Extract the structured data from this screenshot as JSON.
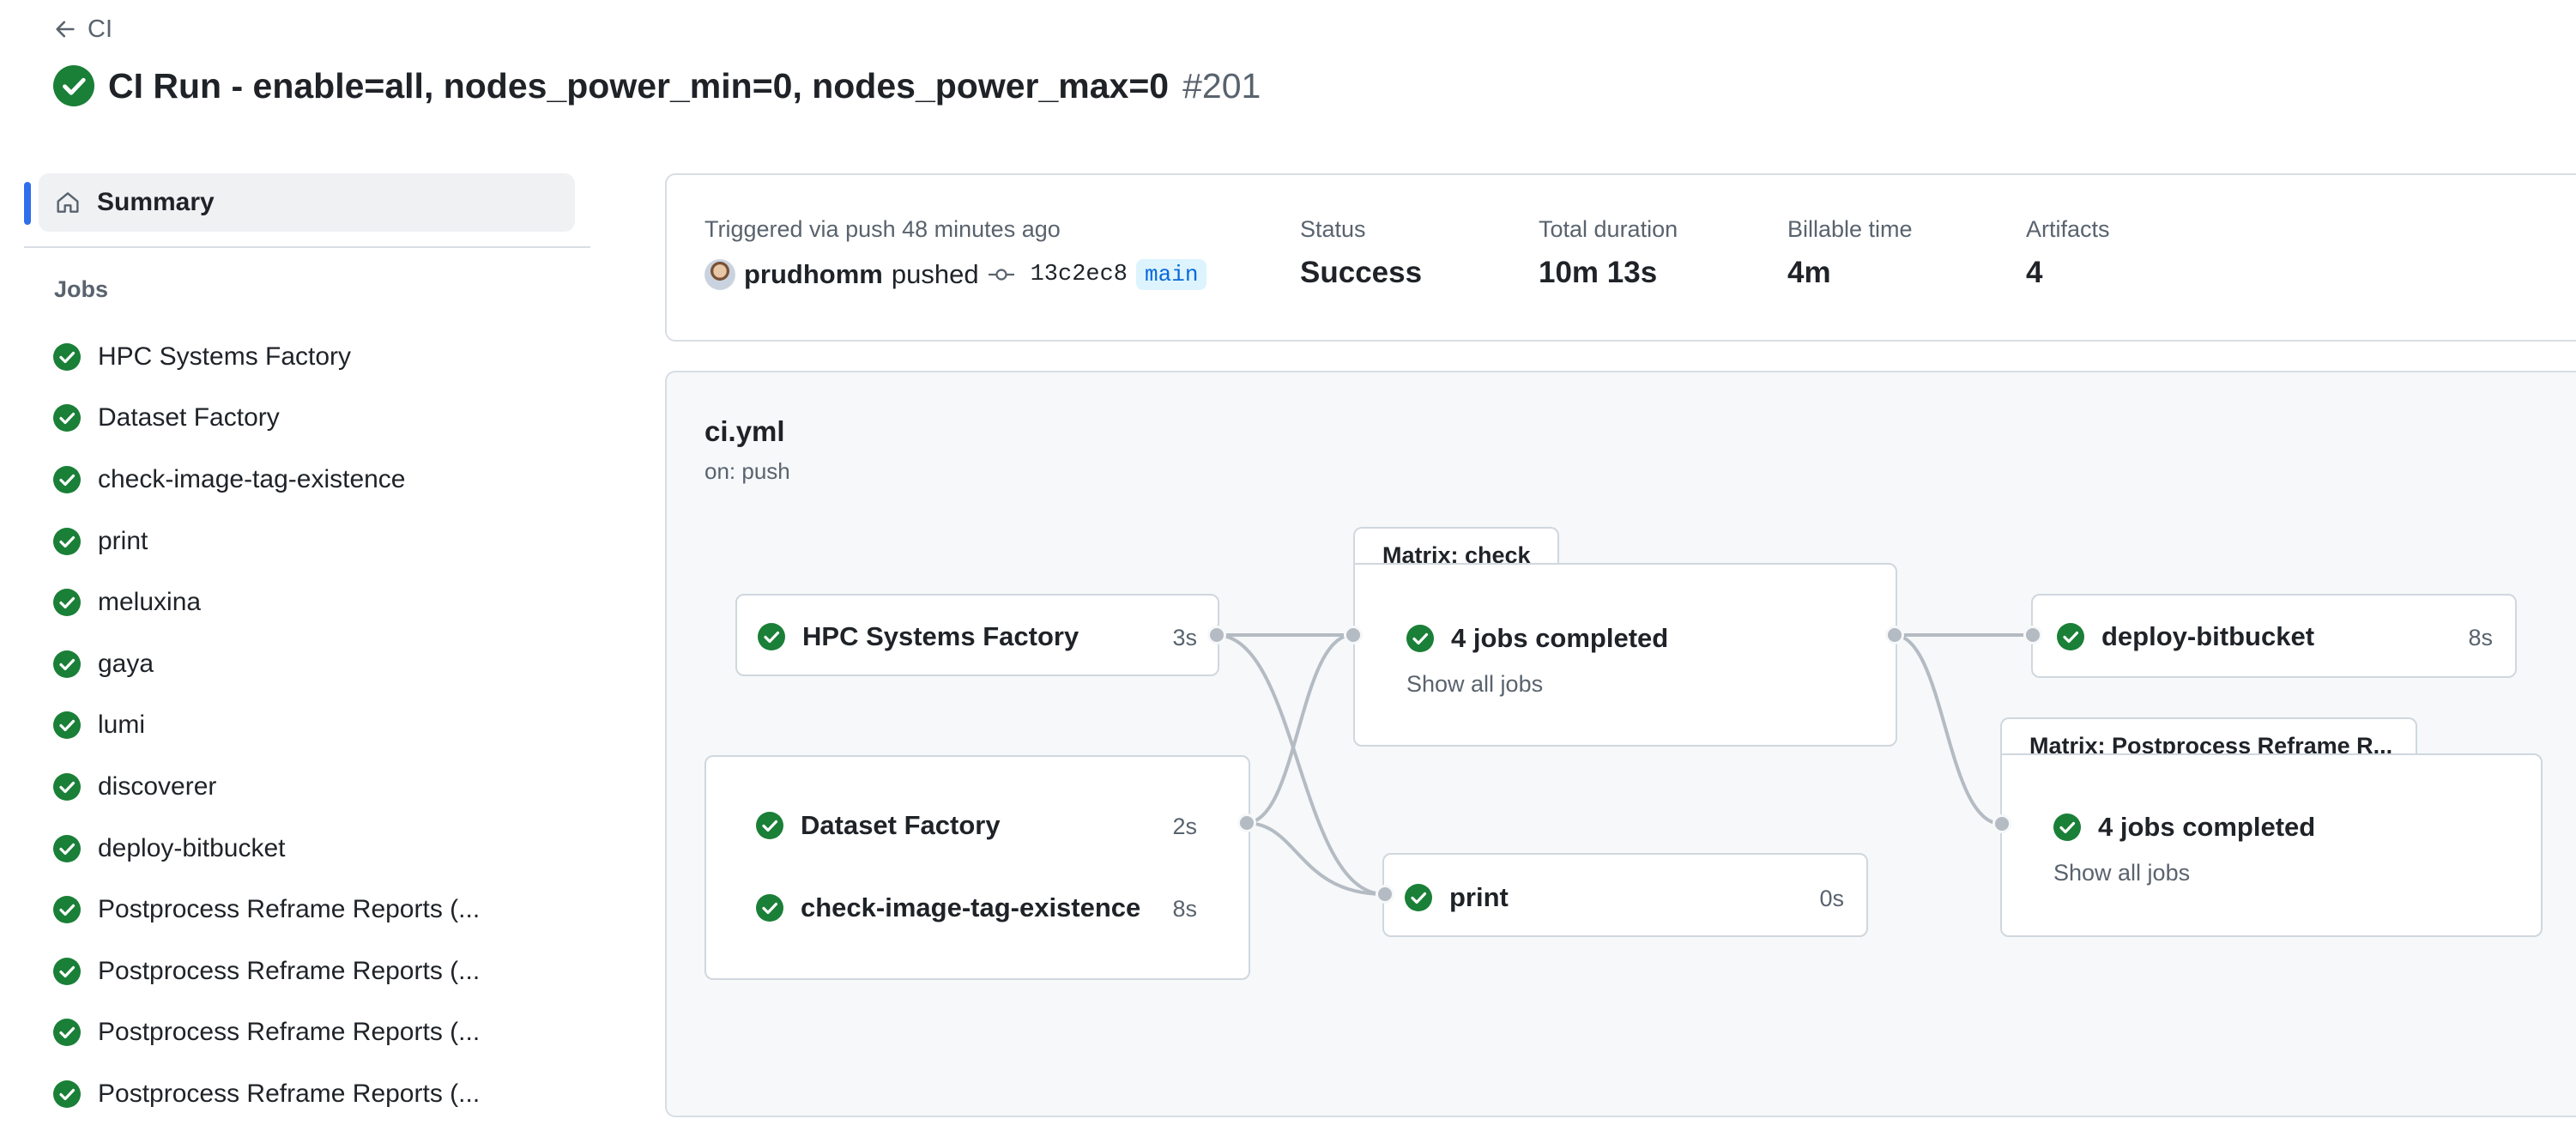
{
  "header": {
    "back_label": "CI",
    "title": "CI Run - enable=all, nodes_power_min=0, nodes_power_max=0",
    "run_number": "#201"
  },
  "sidebar": {
    "summary_label": "Summary",
    "jobs_heading": "Jobs",
    "jobs": [
      "HPC Systems Factory",
      "Dataset Factory",
      "check-image-tag-existence",
      "print",
      "meluxina",
      "gaya",
      "lumi",
      "discoverer",
      "deploy-bitbucket",
      "Postprocess Reframe Reports (...",
      "Postprocess Reframe Reports (...",
      "Postprocess Reframe Reports (...",
      "Postprocess Reframe Reports (..."
    ]
  },
  "summary": {
    "triggered": "Triggered via push 48 minutes ago",
    "user": "prudhomm",
    "action": "pushed",
    "commit": "13c2ec8",
    "branch": "main",
    "status_label": "Status",
    "status_value": "Success",
    "duration_label": "Total duration",
    "duration_value": "10m 13s",
    "billable_label": "Billable time",
    "billable_value": "4m",
    "artifacts_label": "Artifacts",
    "artifacts_value": "4"
  },
  "workflow": {
    "file": "ci.yml",
    "trigger": "on: push",
    "jobs": {
      "hpc": {
        "name": "HPC Systems Factory",
        "duration": "3s"
      },
      "dataset": {
        "name": "Dataset Factory",
        "duration": "2s"
      },
      "checkimg": {
        "name": "check-image-tag-existence",
        "duration": "8s"
      },
      "print": {
        "name": "print",
        "duration": "0s"
      },
      "deploy": {
        "name": "deploy-bitbucket",
        "duration": "8s"
      }
    },
    "matrix_check": {
      "title": "Matrix: check",
      "completed": "4 jobs completed",
      "show": "Show all jobs"
    },
    "matrix_post": {
      "title": "Matrix: Postprocess Reframe R...",
      "completed": "4 jobs completed",
      "show": "Show all jobs"
    }
  },
  "colors": {
    "success": "#1a7f37",
    "accent": "#2f6feb",
    "link": "#0969da"
  }
}
